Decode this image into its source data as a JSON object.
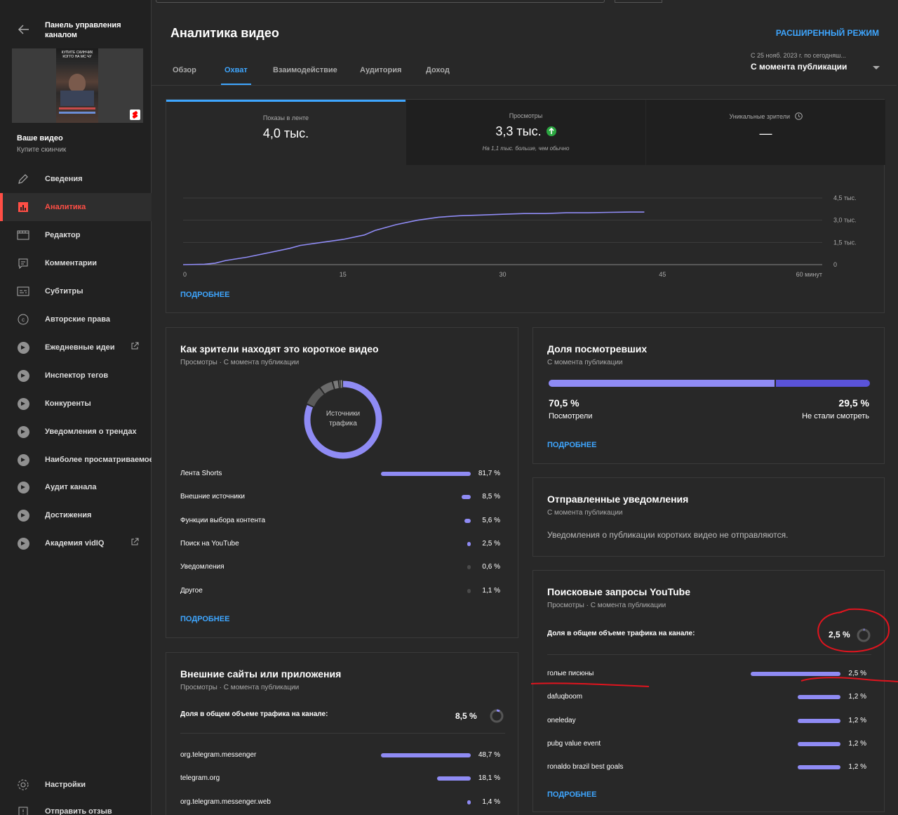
{
  "sidebar": {
    "panel_title": "Панель управления каналом",
    "thumb_caption": "Купите скинчик когго на мс чу",
    "your_video": "Ваше видео",
    "video_name": "Купите скинчик",
    "items": [
      {
        "label": "Сведения",
        "icon": "pencil-icon"
      },
      {
        "label": "Аналитика",
        "icon": "analytics-icon"
      },
      {
        "label": "Редактор",
        "icon": "film-icon"
      },
      {
        "label": "Комментарии",
        "icon": "comment-icon"
      },
      {
        "label": "Субтитры",
        "icon": "subtitles-icon"
      },
      {
        "label": "Авторские права",
        "icon": "copyright-icon"
      },
      {
        "label": "Ежедневные идеи",
        "icon": "vidiq-icon"
      },
      {
        "label": "Инспектор тегов",
        "icon": "vidiq-icon"
      },
      {
        "label": "Конкуренты",
        "icon": "vidiq-icon"
      },
      {
        "label": "Уведомления о трендах",
        "icon": "vidiq-icon"
      },
      {
        "label": "Наиболее просматриваемое",
        "icon": "vidiq-icon"
      },
      {
        "label": "Аудит канала",
        "icon": "vidiq-icon"
      },
      {
        "label": "Достижения",
        "icon": "vidiq-icon"
      },
      {
        "label": "Академия vidIQ",
        "icon": "vidiq-icon"
      }
    ],
    "settings": "Настройки",
    "feedback": "Отправить отзыв"
  },
  "header": {
    "title": "Аналитика видео",
    "advanced_mode": "РАСШИРЕННЫЙ РЕЖИМ",
    "tabs": [
      "Обзор",
      "Охват",
      "Взаимодействие",
      "Аудитория",
      "Доход"
    ],
    "active_tab": 1,
    "date_small": "С 25 нояб. 2023 г. по сегодняш...",
    "date_main": "С момента публикации"
  },
  "metrics": [
    {
      "label": "Показы в ленте",
      "value": "4,0 тыс.",
      "sub": ""
    },
    {
      "label": "Просмотры",
      "value": "3,3 тыс.",
      "sub": "На 1,1 тыс. больше, чем обычно"
    },
    {
      "label": "Уникальные зрители",
      "value": "—",
      "sub": ""
    }
  ],
  "chart_data": {
    "type": "line",
    "title": "",
    "xlabel": "",
    "ylabel": "",
    "x_ticks": [
      "0",
      "15",
      "30",
      "45",
      "60 минут"
    ],
    "y_ticks": [
      "4,5 тыс.",
      "3,0 тыс.",
      "1,5 тыс.",
      "0"
    ],
    "xlim": [
      0,
      60
    ],
    "ylim": [
      0,
      4500
    ],
    "series": [
      {
        "x": [
          0,
          2,
          3,
          4,
          6,
          8,
          10,
          11,
          13,
          15,
          17,
          18,
          20,
          22,
          24,
          26,
          28,
          30,
          32,
          34,
          36,
          38,
          40,
          42,
          43.3
        ],
        "y": [
          0,
          30,
          100,
          280,
          500,
          800,
          1100,
          1300,
          1500,
          1700,
          2000,
          2300,
          2700,
          3000,
          3200,
          3300,
          3350,
          3400,
          3450,
          3450,
          3500,
          3500,
          3530,
          3550,
          3550
        ]
      }
    ],
    "grid": true
  },
  "chart_more": "ПОДРОБНЕЕ",
  "traffic": {
    "title": "Как зрители находят это короткое видео",
    "sub": "Просмотры · С момента публикации",
    "donut_label": "Источники трафика",
    "rows": [
      {
        "label": "Лента Shorts",
        "value": "81,7 %",
        "pct": 81.7
      },
      {
        "label": "Внешние источники",
        "value": "8,5 %",
        "pct": 8.5
      },
      {
        "label": "Функции выбора контента",
        "value": "5,6 %",
        "pct": 5.6
      },
      {
        "label": "Поиск на YouTube",
        "value": "2,5 %",
        "pct": 2.5
      },
      {
        "label": "Уведомления",
        "value": "0,6 %",
        "pct": 0.6
      },
      {
        "label": "Другое",
        "value": "1,1 %",
        "pct": 1.1
      }
    ],
    "more": "ПОДРОБНЕЕ"
  },
  "external": {
    "title": "Внешние сайты или приложения",
    "sub": "Просмотры · С момента публикации",
    "share_label": "Доля в общем объеме трафика на канале:",
    "share_value": "8,5 %",
    "share_pct": 8.5,
    "rows": [
      {
        "label": "org.telegram.messenger",
        "value": "48,7 %",
        "pct": 48.7
      },
      {
        "label": "telegram.org",
        "value": "18,1 %",
        "pct": 18.1
      },
      {
        "label": "org.telegram.messenger.web",
        "value": "1,4 %",
        "pct": 1.4
      }
    ]
  },
  "watched": {
    "title": "Доля посмотревших",
    "sub": "С момента публикации",
    "watched_value": "70,5 %",
    "watched_label": "Посмотрели",
    "watched_pct": 70.5,
    "skipped_value": "29,5 %",
    "skipped_label": "Не стали смотреть",
    "more": "ПОДРОБНЕЕ"
  },
  "notifications": {
    "title": "Отправленные уведомления",
    "sub": "С момента публикации",
    "text": "Уведомления о публикации коротких видео не отправляются."
  },
  "search": {
    "title": "Поисковые запросы YouTube",
    "sub": "Просмотры · С момента публикации",
    "share_label": "Доля в общем объеме трафика на канале:",
    "share_value": "2,5 %",
    "share_pct": 2.5,
    "rows": [
      {
        "label": "голые писюны",
        "value": "2,5 %",
        "pct": 2.5
      },
      {
        "label": "dafuqboom",
        "value": "1,2 %",
        "pct": 1.2
      },
      {
        "label": "oneleday",
        "value": "1,2 %",
        "pct": 1.2
      },
      {
        "label": "pubg value event",
        "value": "1,2 %",
        "pct": 1.2
      },
      {
        "label": "ronaldo brazil best goals",
        "value": "1,2 %",
        "pct": 1.2
      }
    ],
    "more": "ПОДРОБНЕЕ"
  },
  "colors": {
    "accent": "#3ea6ff",
    "bar": "#8f8bf4",
    "active_nav": "#ff4e45",
    "annotation": "#e0141e"
  }
}
